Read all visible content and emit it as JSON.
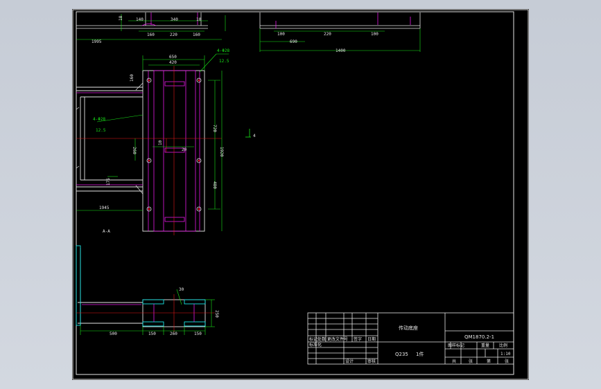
{
  "drawing": {
    "top_view": {
      "dims_top": [
        "140",
        "340",
        "10",
        "18"
      ],
      "dims_mid": [
        "160",
        "220",
        "160"
      ],
      "dim_total": "1995"
    },
    "right_view": {
      "dims_mid": [
        "100",
        "220",
        "100"
      ],
      "dim_left": "690",
      "dim_total": "1400"
    },
    "plan_view": {
      "dim_top_outer": "650",
      "dim_top_inner": "420",
      "hole_spec_top": "4-Φ28",
      "hole_spec_top_sub": "12.5",
      "hole_spec_left": "4-Φ28",
      "hole_spec_left_sub": "12.5",
      "dim_right_upper": "720",
      "dim_right_total": "1920",
      "dim_right_lower": "480",
      "dim_center_left": "260",
      "dim_center_a": "10",
      "dim_center_b": "20",
      "dim_left_small": "175",
      "dim_bottom_left": "1945",
      "dim_top_left_small": "160",
      "section_label": "A-A",
      "view_marker": "4"
    },
    "front_view": {
      "dims_bottom": [
        "500",
        "150",
        "260",
        "150"
      ],
      "dim_right": "250",
      "dim_flange": "30"
    }
  },
  "title_block": {
    "part_name": "传动底座",
    "drawing_no": "QM1870.2-1",
    "material": "Q235",
    "quantity_label": "1件",
    "scale_headers": [
      "图样标记",
      "重量",
      "比例"
    ],
    "scale_value": "1:10",
    "sheet_labels": [
      "共",
      "张",
      "第",
      "张"
    ],
    "left_labels": [
      "标记",
      "处数",
      "更改文件号",
      "签字",
      "日期"
    ],
    "bottom_labels": [
      "设计",
      "审核"
    ],
    "left_labels2": [
      "标准化"
    ]
  },
  "colors": {
    "background": "#000000",
    "line_white": "#e6e6e6",
    "line_green": "#19e619",
    "line_magenta": "#e619e6",
    "line_red": "#e61919",
    "line_cyan": "#19e6e6"
  }
}
